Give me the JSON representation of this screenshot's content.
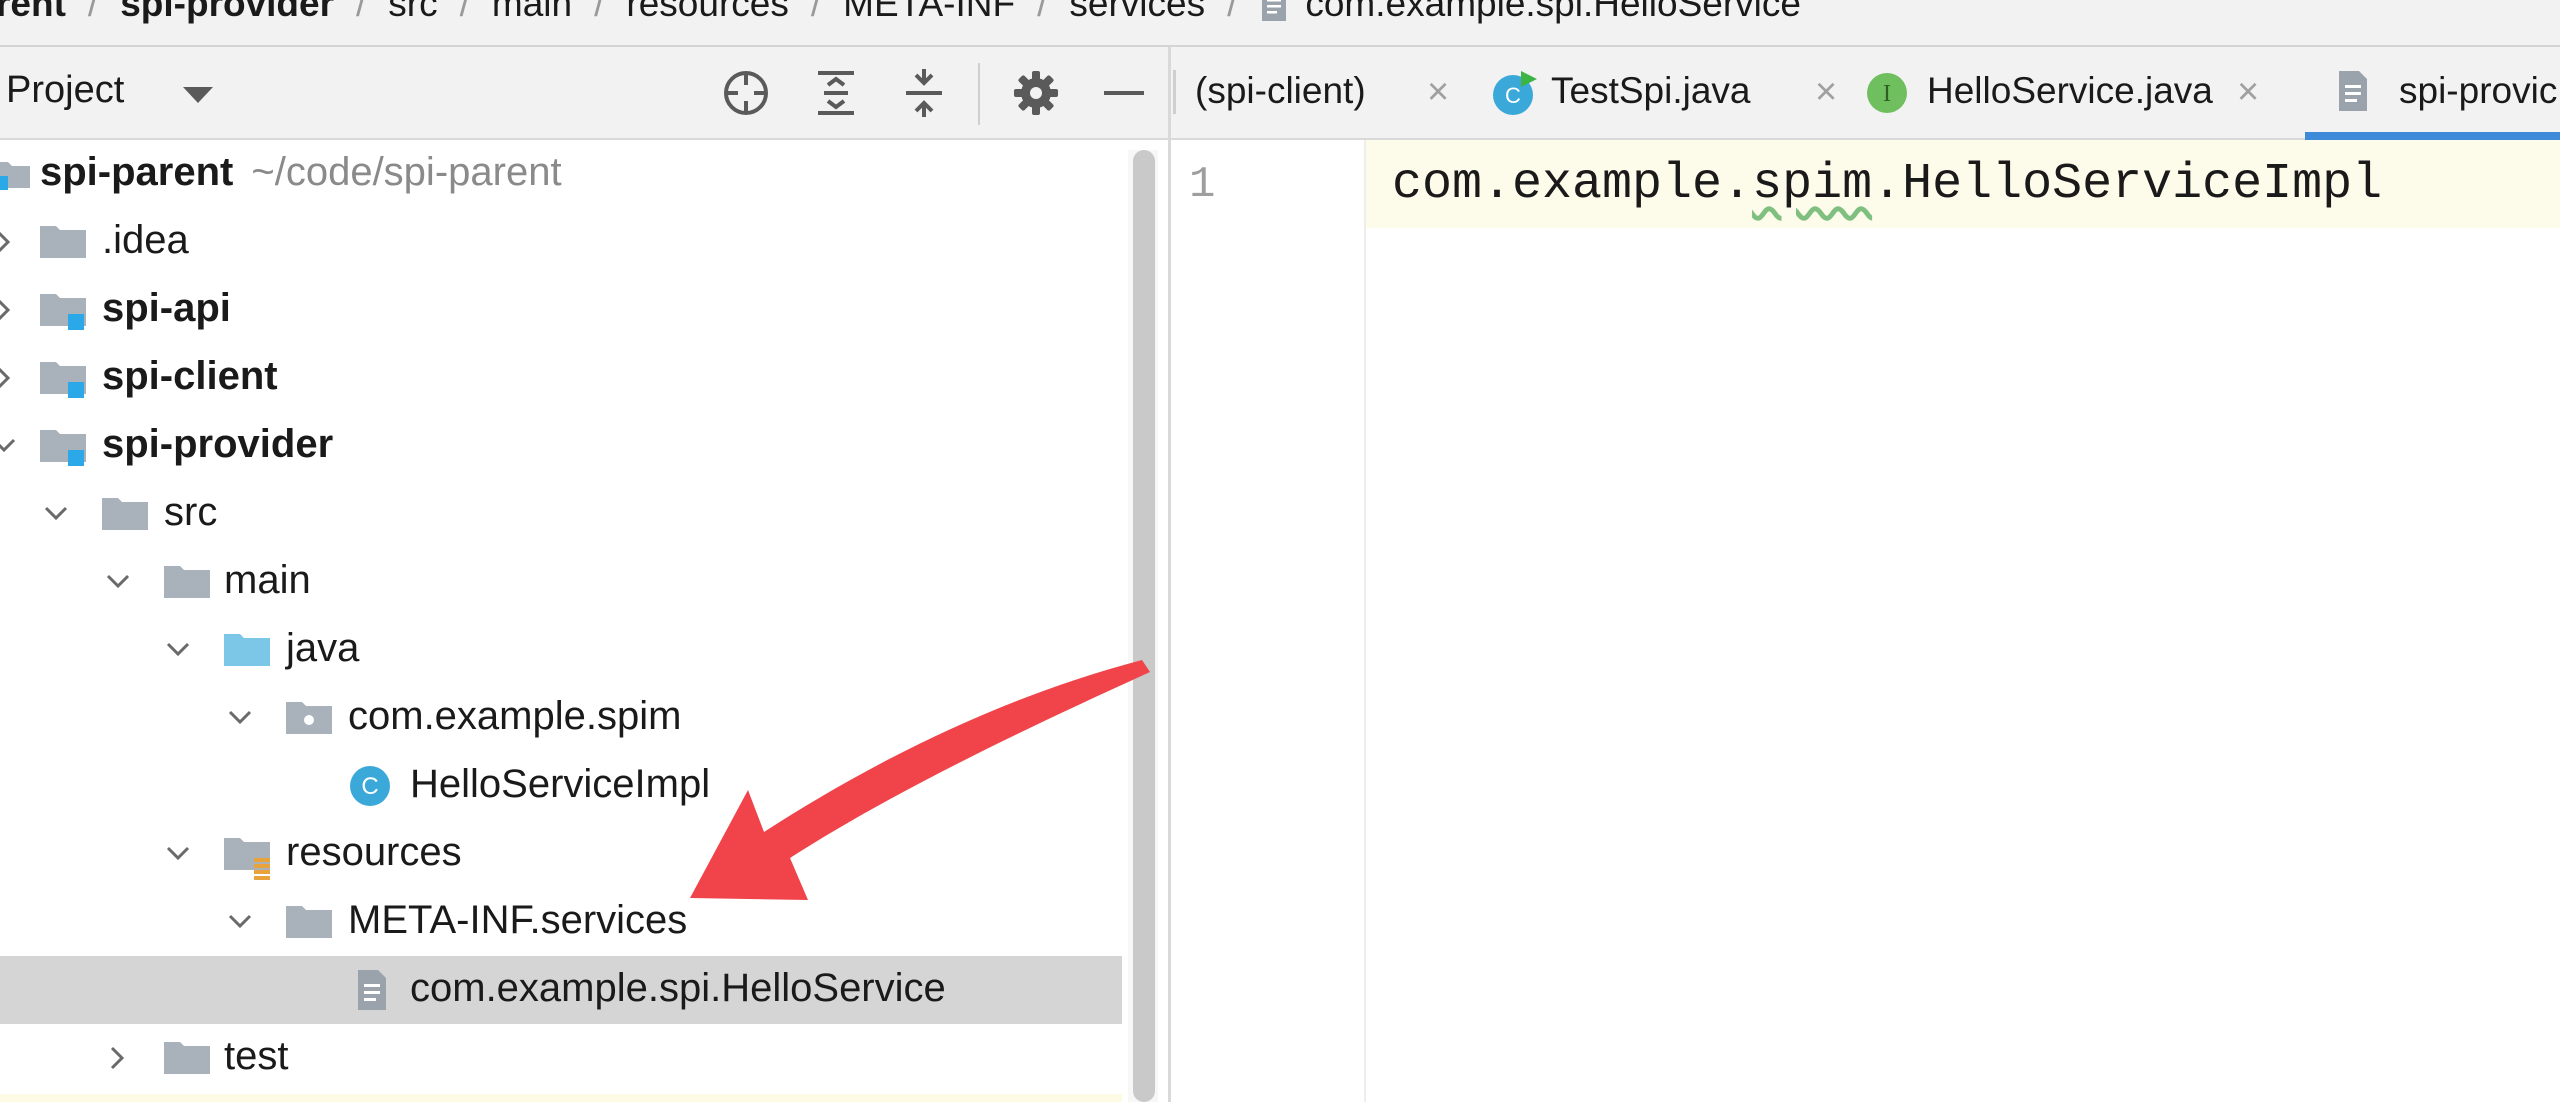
{
  "breadcrumb": {
    "items": [
      {
        "label": "rent",
        "bold": true
      },
      {
        "label": "spi-provider",
        "bold": true
      },
      {
        "label": "src",
        "bold": false
      },
      {
        "label": "main",
        "bold": false
      },
      {
        "label": "resources",
        "bold": false
      },
      {
        "label": "META-INF",
        "bold": false
      },
      {
        "label": "services",
        "bold": false
      },
      {
        "label": "com.example.spi.HelloService",
        "bold": false
      }
    ],
    "separator": "/"
  },
  "project_panel": {
    "title": "Project",
    "header_icons": [
      "locate-icon",
      "expand-all-icon",
      "collapse-all-icon",
      "gear-icon",
      "hide-icon"
    ]
  },
  "tree": {
    "root_label": "spi-parent",
    "root_path": "~/code/spi-parent",
    "idea": ".idea",
    "spi_api": "spi-api",
    "spi_client": "spi-client",
    "spi_provider": "spi-provider",
    "src": "src",
    "main": "main",
    "java": "java",
    "package": "com.example.spim",
    "impl_class": "HelloServiceImpl",
    "resources": "resources",
    "meta_inf": "META-INF.services",
    "service_file": "com.example.spi.HelloService",
    "test": "test"
  },
  "tabs": [
    {
      "label": "(spi-client)",
      "close": "×"
    },
    {
      "label": "TestSpi.java",
      "close": "×"
    },
    {
      "label": "HelloService.java",
      "close": "×"
    },
    {
      "label": "spi-provic",
      "close": ""
    }
  ],
  "tab_icons": {
    "testspi": "C",
    "helloservice": "I"
  },
  "editor": {
    "line_number": "1",
    "code_before": "com.example.",
    "code_typo": "spim",
    "code_after": ".HelloServiceImpl"
  },
  "tree_icons": {
    "class_letter": "C"
  },
  "colors": {
    "accent": "#3d8bd8",
    "selection": "#d5d5d5",
    "arrow": "#f0444a",
    "folder": "#a9b2bb",
    "source_folder": "#7cc7e8",
    "class_icon": "#3aa8d8",
    "interface_icon": "#6fbf5f"
  }
}
